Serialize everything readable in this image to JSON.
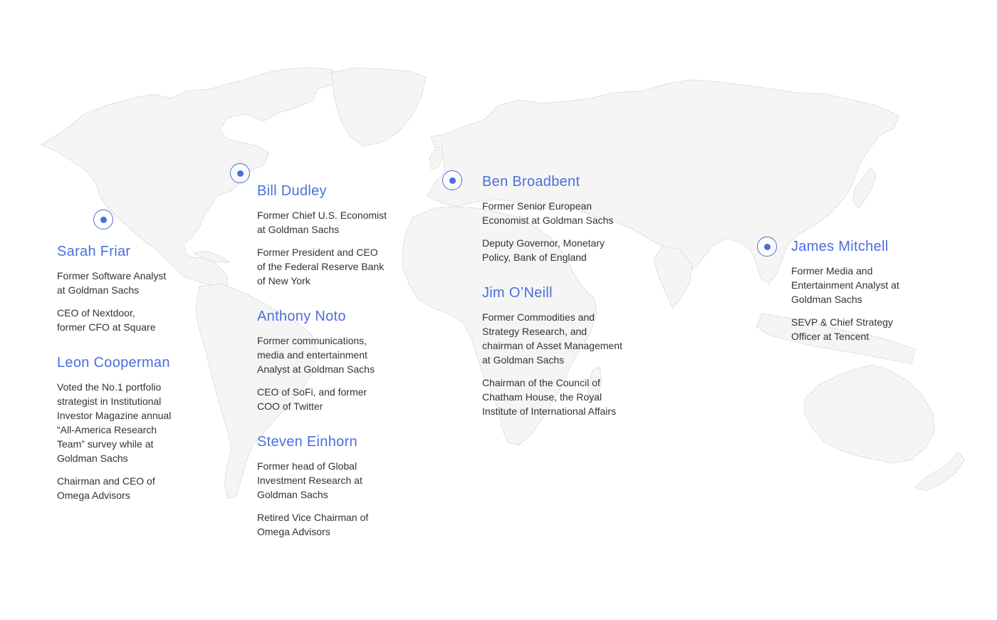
{
  "pins": [
    {
      "name": "pin-san-francisco"
    },
    {
      "name": "pin-new-york"
    },
    {
      "name": "pin-london"
    },
    {
      "name": "pin-shenzhen"
    }
  ],
  "profiles": [
    {
      "name": "Sarah Friar",
      "lines": [
        "Former Software Analyst\nat Goldman Sachs",
        "CEO of Nextdoor,\nformer CFO at Square"
      ]
    },
    {
      "name": "Leon Cooperman",
      "lines": [
        "Voted the No.1 portfolio\nstrategist in Institutional\nInvestor Magazine annual\n“All-America Research\nTeam” survey while at\nGoldman Sachs",
        "Chairman and CEO of\nOmega Advisors"
      ]
    },
    {
      "name": "Bill Dudley",
      "lines": [
        "Former Chief U.S. Economist\nat Goldman Sachs",
        "Former President and CEO\nof the Federal Reserve Bank\nof New York"
      ]
    },
    {
      "name": "Anthony Noto",
      "lines": [
        "Former communications,\nmedia and entertainment\nAnalyst at Goldman Sachs",
        "CEO of SoFi, and former\nCOO of Twitter"
      ]
    },
    {
      "name": "Steven Einhorn",
      "lines": [
        "Former head of Global\nInvestment Research at\nGoldman Sachs",
        "Retired Vice Chairman of\nOmega Advisors"
      ]
    },
    {
      "name": "Ben Broadbent",
      "lines": [
        "Former Senior European\nEconomist at Goldman Sachs",
        "Deputy Governor, Monetary\nPolicy, Bank of England"
      ]
    },
    {
      "name": "Jim O’Neill",
      "lines": [
        "Former Commodities and\nStrategy Research, and\nchairman of Asset Management\nat Goldman Sachs",
        "Chairman of the Council of\nChatham House, the Royal\nInstitute of International Affairs"
      ]
    },
    {
      "name": "James Mitchell",
      "lines": [
        "Former Media and\nEntertainment Analyst at\nGoldman Sachs",
        "SEVP & Chief Strategy\nOfficer at Tencent"
      ]
    }
  ]
}
